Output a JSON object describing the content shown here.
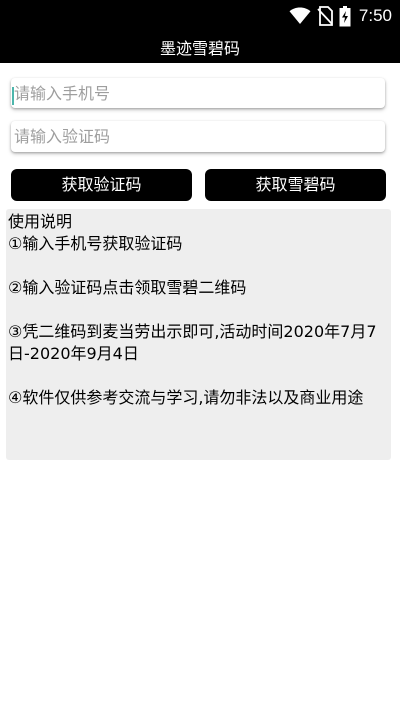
{
  "status_bar": {
    "time": "7:50",
    "icons": [
      "wifi-icon",
      "no-sim-icon",
      "battery-charging-icon"
    ]
  },
  "app": {
    "title": "墨迹雪碧码"
  },
  "form": {
    "phone_placeholder": "请输入手机号",
    "code_placeholder": "请输入验证码"
  },
  "buttons": {
    "get_code": "获取验证码",
    "get_coupon": "获取雪碧码"
  },
  "instructions": {
    "heading": "使用说明",
    "steps": [
      " ①输入手机号获取验证码",
      " ②输入验证码点击领取雪碧二维码",
      " ③凭二维码到麦当劳出示即可,活动时间2020年7月7日-2020年9月4日",
      " ④软件仅供参考交流与学习,请勿非法以及商业用途"
    ]
  }
}
